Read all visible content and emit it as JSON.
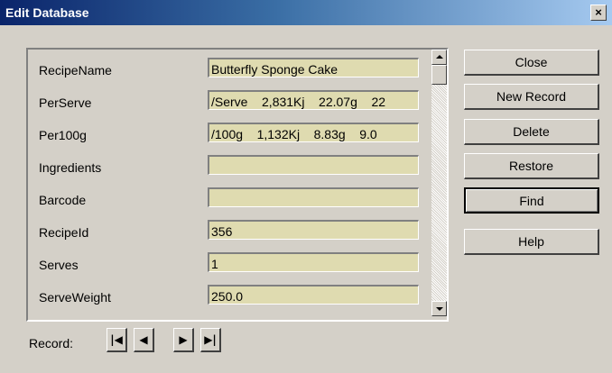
{
  "window": {
    "title": "Edit Database",
    "close_glyph": "×"
  },
  "fields": [
    {
      "label": "RecipeName",
      "value": "Butterfly Sponge Cake"
    },
    {
      "label": "PerServe",
      "value": "/Serve    2,831Kj    22.07g    22"
    },
    {
      "label": "Per100g",
      "value": "/100g    1,132Kj    8.83g    9.0"
    },
    {
      "label": "Ingredients",
      "value": ""
    },
    {
      "label": "Barcode",
      "value": ""
    },
    {
      "label": "RecipeId",
      "value": "356"
    },
    {
      "label": "Serves",
      "value": "1"
    },
    {
      "label": "ServeWeight",
      "value": "250.0"
    }
  ],
  "buttons": {
    "close": "Close",
    "new_record": "New Record",
    "delete": "Delete",
    "restore": "Restore",
    "find": "Find",
    "help": "Help"
  },
  "navigation": {
    "label": "Record:",
    "first_icon": "first-record-icon",
    "prev_icon": "previous-record-icon",
    "next_icon": "next-record-icon",
    "last_icon": "last-record-icon"
  },
  "colors": {
    "field_background": "#dfdbb0",
    "title_bar_start": "#0a246a",
    "dialog_background": "#d4d0c8"
  }
}
